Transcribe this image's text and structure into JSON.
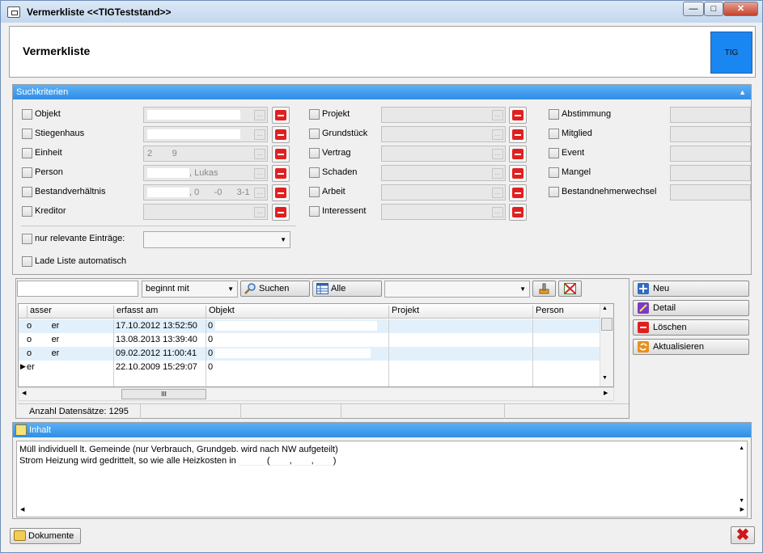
{
  "window": {
    "title": "Vermerkliste  <<TIGTeststand>>"
  },
  "header": {
    "title": "Vermerkliste",
    "logo_text": "TIG"
  },
  "search_panel": {
    "title": "Suchkriterien",
    "col1": [
      {
        "label": "Objekt",
        "value": ""
      },
      {
        "label": "Stiegenhaus",
        "value": ""
      },
      {
        "label": "Einheit",
        "value": "2        9"
      },
      {
        "label": "Person",
        "value": ", Lukas"
      },
      {
        "label": "Bestandverhältnis",
        "value": ", 0      -0      3-1"
      },
      {
        "label": "Kreditor",
        "value": ""
      }
    ],
    "col2": [
      {
        "label": "Projekt"
      },
      {
        "label": "Grundstück"
      },
      {
        "label": "Vertrag"
      },
      {
        "label": "Schaden"
      },
      {
        "label": "Arbeit"
      },
      {
        "label": "Interessent"
      }
    ],
    "col3": [
      {
        "label": "Abstimmung"
      },
      {
        "label": "Mitglied"
      },
      {
        "label": "Event"
      },
      {
        "label": "Mangel"
      },
      {
        "label": "Bestandnehmerwechsel"
      }
    ],
    "relevant_label": "nur relevante Einträge:",
    "autoload_label": "Lade Liste automatisch"
  },
  "search_bar": {
    "mode": "beginnt mit",
    "search_label": "Suchen",
    "all_label": "Alle"
  },
  "table": {
    "columns": [
      "asser",
      "erfasst am",
      "Objekt",
      "Projekt",
      "Person"
    ],
    "rows": [
      {
        "c1": "o        er",
        "date": "17.10.2012 13:52:50",
        "obj": "0"
      },
      {
        "c1": "o        er",
        "date": "13.08.2013 13:39:40",
        "obj": "0"
      },
      {
        "c1": "o        er",
        "date": "09.02.2012 11:00:41",
        "obj": "0"
      },
      {
        "c1": "er",
        "date": "22.10.2009 15:29:07",
        "obj": "0"
      }
    ],
    "hscroll_thumb": "III",
    "status": "Anzahl Datensätze: 1295"
  },
  "side_buttons": {
    "new": "Neu",
    "detail": "Detail",
    "delete": "Löschen",
    "refresh": "Aktualisieren"
  },
  "content": {
    "title": "Inhalt",
    "line1": "Müll individuell lt. Gemeinde (nur Verbrauch, Grundgeb. wird nach NW aufgeteilt)",
    "line2a": "Strom Heizung wird gedrittelt, so wie alle Heizkosten in",
    "line2b": "(",
    "line2c": ",",
    "line2d": ",",
    "line2e": ")"
  },
  "footer": {
    "documents_label": "Dokumente"
  },
  "colors": {
    "accent": "#2f8ee6",
    "logo": "#1a86f2",
    "delete": "#e02020"
  }
}
